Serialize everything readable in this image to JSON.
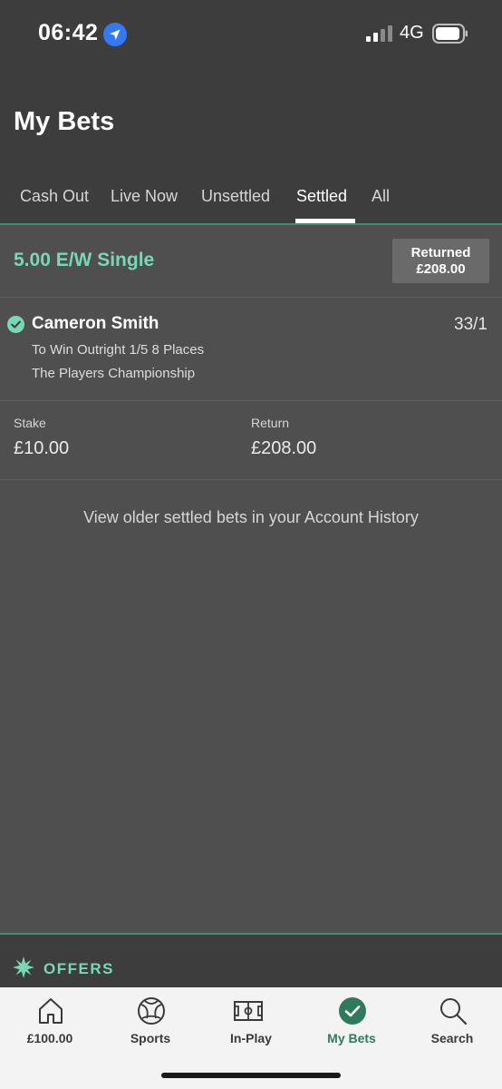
{
  "status_bar": {
    "time": "06:42",
    "network": "4G",
    "location_icon": "location-arrow-icon",
    "signal_icon": "signal-bars-icon",
    "battery_icon": "battery-icon"
  },
  "header": {
    "title": "My Bets",
    "tabs": [
      {
        "label": "Cash Out",
        "active": false
      },
      {
        "label": "Live Now",
        "active": false
      },
      {
        "label": "Unsettled",
        "active": false
      },
      {
        "label": "Settled",
        "active": true
      },
      {
        "label": "All",
        "active": false
      }
    ]
  },
  "bet": {
    "type": "5.00 E/W Single",
    "returned_label": "Returned",
    "returned_value": "£208.00",
    "selection": {
      "name": "Cameron Smith",
      "odds": "33/1",
      "market": "To Win Outright 1/5 8 Places",
      "event": "The Players Championship",
      "status_icon": "check-circle-icon"
    },
    "stake_label": "Stake",
    "stake_value": "£10.00",
    "return_label": "Return",
    "return_value": "£208.00"
  },
  "history_link": "View older settled bets in your Account History",
  "offers": {
    "label": "OFFERS",
    "icon": "starburst-icon"
  },
  "bottom_nav": {
    "items": [
      {
        "label": "£100.00",
        "icon": "home-icon",
        "active": false
      },
      {
        "label": "Sports",
        "icon": "football-icon",
        "active": false
      },
      {
        "label": "In-Play",
        "icon": "pitch-icon",
        "active": false
      },
      {
        "label": "My Bets",
        "icon": "check-circle-icon",
        "active": true
      },
      {
        "label": "Search",
        "icon": "search-icon",
        "active": false
      }
    ]
  },
  "colors": {
    "accent": "#7ad7b5",
    "accent_dark": "#2f7a5d",
    "header_bg": "#3d3d3d",
    "content_bg": "#4f4f4f",
    "ios_blue": "#3478f6"
  }
}
